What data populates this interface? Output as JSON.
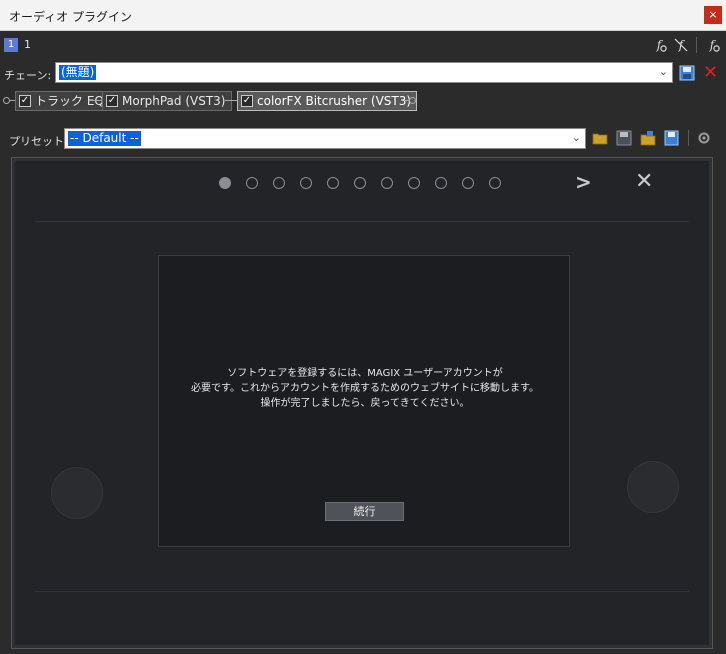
{
  "window": {
    "title": "オーディオ プラグイン",
    "close_label": "×"
  },
  "toolbar": {
    "badge_number": "1",
    "badge_label": "1",
    "fx_icon_glyph": "f"
  },
  "chain": {
    "label": "チェーン:",
    "value": "(無題)",
    "arrow": "⌄",
    "delete_glyph": "✕"
  },
  "plugins": [
    {
      "label": "トラック EQ",
      "checked": true
    },
    {
      "label": "MorphPad (VST3)",
      "checked": true
    },
    {
      "label": "colorFX Bitcrusher (VST3)",
      "checked": true,
      "active": true
    }
  ],
  "checkmark": "✓",
  "preset": {
    "label": "プリセット:",
    "value": "-- Default --",
    "arrow": "⌄"
  },
  "dialog": {
    "page_count": 11,
    "current_page": 1,
    "next_glyph": ">",
    "close_glyph": "✕",
    "message_lines": [
      "ソフトウェアを登録するには、MAGIX ユーザーアカウントが",
      "必要です。これからアカウントを作成するためのウェブサイトに移動します。",
      "操作が完了しましたら、戻ってきてください。"
    ],
    "continue_label": "続行"
  },
  "colors": {
    "accent": "#0a64d8",
    "close": "#c42b1c",
    "delete": "#e02020",
    "folder": "#c9a227"
  }
}
